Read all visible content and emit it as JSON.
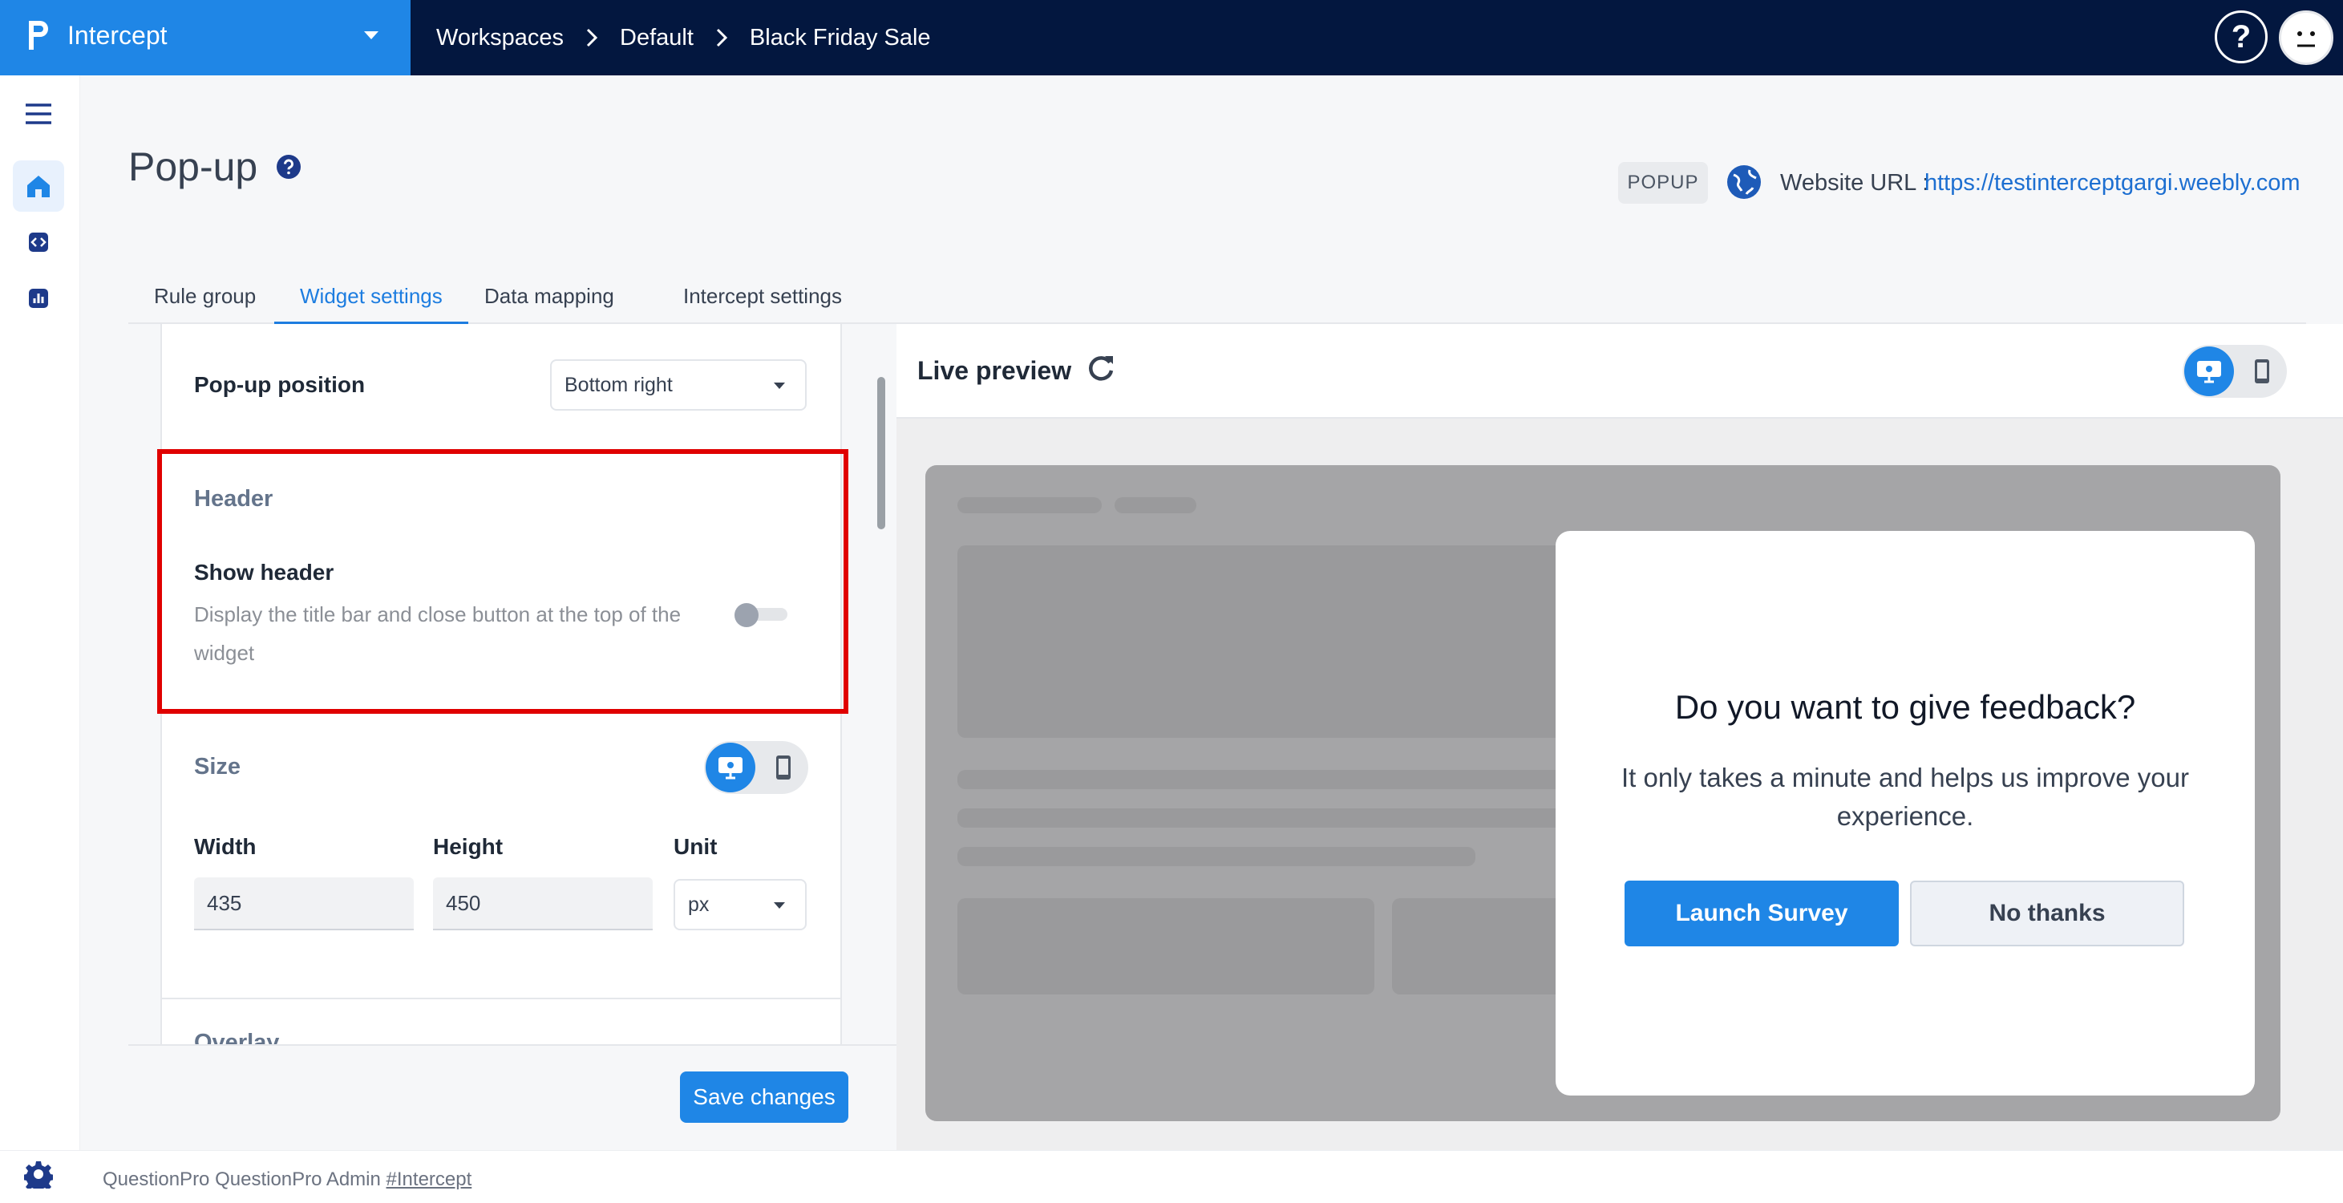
{
  "topbar": {
    "brand": "Intercept",
    "breadcrumbs": [
      "Workspaces",
      "Default",
      "Black Friday Sale"
    ],
    "help_label": "?"
  },
  "page": {
    "title": "Pop-up",
    "type_badge": "POPUP",
    "url_label": "Website URL :",
    "url": "https://testinterceptgargi.weebly.com"
  },
  "tabs": [
    {
      "label": "Rule group",
      "active": false
    },
    {
      "label": "Widget settings",
      "active": true
    },
    {
      "label": "Data mapping",
      "active": false
    },
    {
      "label": "Intercept settings",
      "active": false
    }
  ],
  "settings": {
    "popup_position_label": "Pop-up position",
    "popup_position_value": "Bottom right",
    "header_section": "Header",
    "show_header_label": "Show header",
    "show_header_desc": "Display the title bar and close button at the top of the widget",
    "show_header_enabled": false,
    "size_section": "Size",
    "width_label": "Width",
    "width_value": "435",
    "height_label": "Height",
    "height_value": "450",
    "unit_label": "Unit",
    "unit_value": "px",
    "overlay_section": "Overlay",
    "save_label": "Save changes"
  },
  "preview": {
    "title": "Live preview",
    "popup_title": "Do you want to give feedback?",
    "popup_body": "It only takes a minute and helps us improve your experience.",
    "launch_label": "Launch Survey",
    "decline_label": "No thanks"
  },
  "footer": {
    "text": "QuestionPro  QuestionPro Admin",
    "link": "#Intercept"
  },
  "colors": {
    "brand_blue": "#1f86e6",
    "topbar_navy": "#03173f",
    "highlight_red": "#e00000"
  },
  "icons": [
    "brand-logo-icon",
    "chevron-down-icon",
    "chevron-right-icon",
    "help-icon",
    "avatar-icon",
    "menu-icon",
    "home-icon",
    "code-icon",
    "chart-icon",
    "globe-icon",
    "refresh-icon",
    "desktop-icon",
    "mobile-icon",
    "gear-icon"
  ]
}
